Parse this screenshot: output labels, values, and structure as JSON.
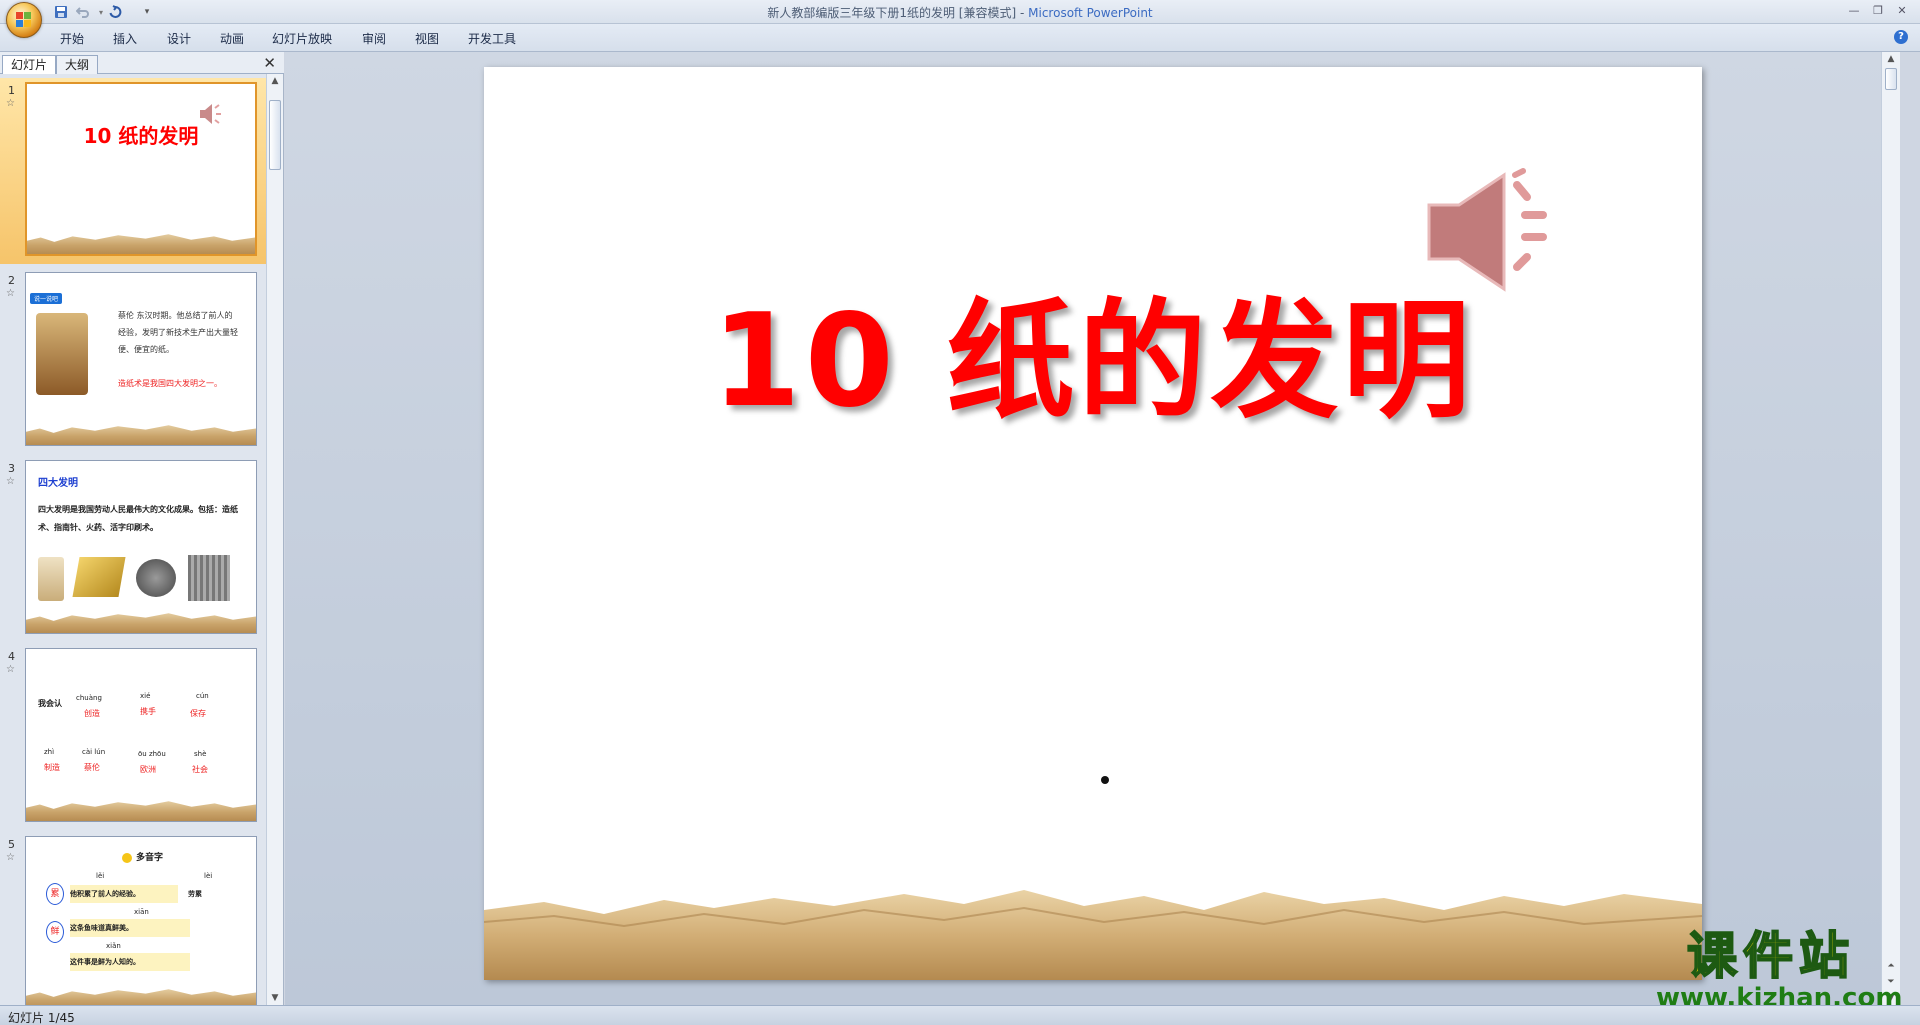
{
  "window": {
    "title_doc": "新人教部编版三年级下册1纸的发明 [兼容模式]",
    "title_sep": " - ",
    "title_app": "Microsoft PowerPoint"
  },
  "ribbon": {
    "tabs": [
      "开始",
      "插入",
      "设计",
      "动画",
      "幻灯片放映",
      "审阅",
      "视图",
      "开发工具"
    ]
  },
  "left_pane": {
    "tabs": [
      "幻灯片",
      "大纲"
    ],
    "close_icon": "close-icon"
  },
  "thumbnails": [
    {
      "num": "1",
      "title": "10 纸的发明"
    },
    {
      "num": "2",
      "badge": "说一说吧",
      "text_a": "蔡伦 东汉时期。他总结了前人的经验，发明了新技术生产出大量轻便、便宜的纸。",
      "text_b": "造纸术是我国四大发明之一。"
    },
    {
      "num": "3",
      "heading": "四大发明",
      "text": "四大发明是我国劳动人民最伟大的文化成果。包括：造纸术、指南针、火药、活字印刷术。"
    },
    {
      "num": "4",
      "label": "我会认",
      "items": [
        {
          "py": "chuàng",
          "hz": "创造"
        },
        {
          "py": "xié",
          "hz": "携手"
        },
        {
          "py": "cún",
          "hz": "保存"
        },
        {
          "py": "zhì",
          "hz": "制造"
        },
        {
          "py": "cài lún",
          "hz": "蔡伦"
        },
        {
          "py": "ōu zhōu",
          "hz": "欧洲"
        },
        {
          "py": "shè",
          "hz": "社会"
        }
      ]
    },
    {
      "num": "5",
      "heading": "多音字",
      "rows": [
        {
          "py": "lěi",
          "char": "累",
          "text": "他积累了前人的经验。",
          "py2": "lèi",
          "extra": "劳累"
        },
        {
          "py": "xiān",
          "char": "鲜",
          "text": "这条鱼味道真鲜美。"
        },
        {
          "py": "xiǎn",
          "text": "这件事是鲜为人知的。"
        }
      ]
    }
  ],
  "slide": {
    "title": "10 纸的发明"
  },
  "watermark": {
    "cn": "课件站",
    "en": "www.kjzhan.com"
  },
  "status": {
    "text": "幻灯片 1/45"
  },
  "colors": {
    "title_red": "#ff0000",
    "accent_orange": "#f6c46a"
  }
}
